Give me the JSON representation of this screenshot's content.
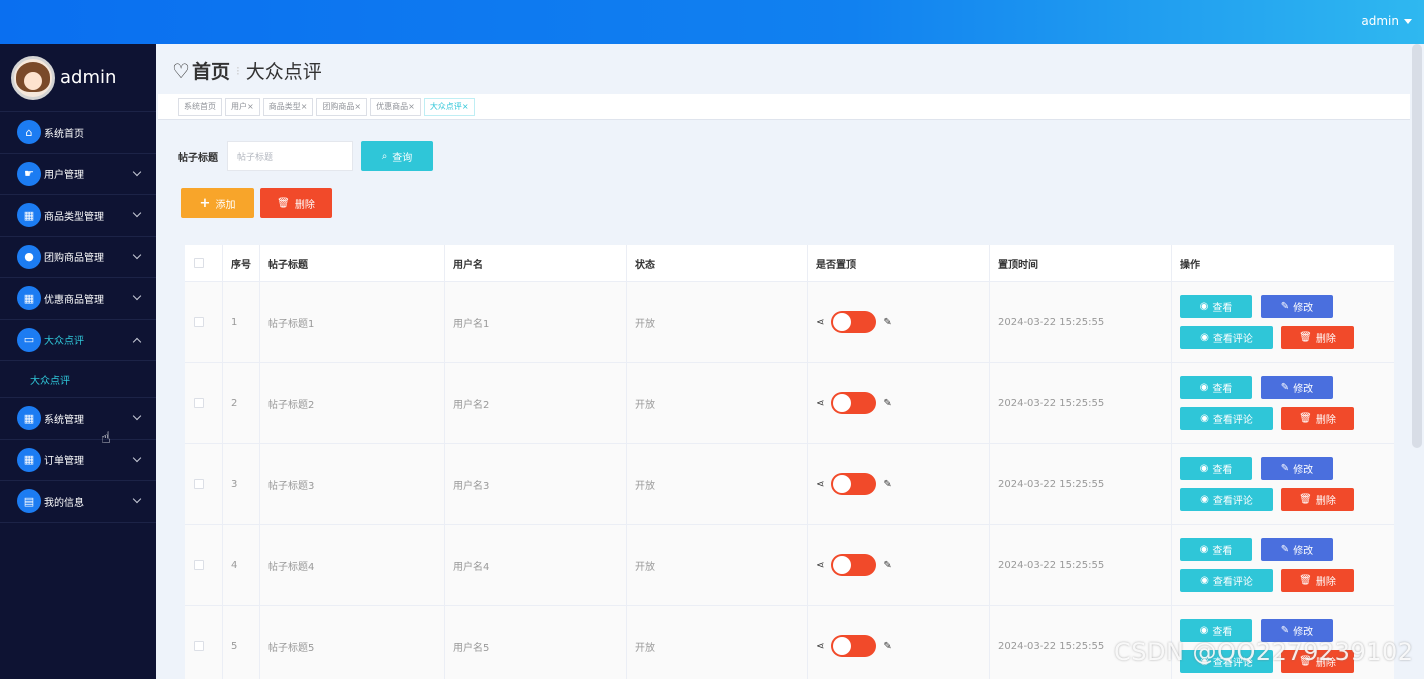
{
  "topbar": {
    "user_label": "admin"
  },
  "sidebar": {
    "admin_name": "admin",
    "items": [
      {
        "label": "系统首页",
        "icon": "home-icon",
        "expand": ""
      },
      {
        "label": "用户管理",
        "icon": "user-manage-icon",
        "expand": "down"
      },
      {
        "label": "商品类型管理",
        "icon": "grid-icon",
        "expand": "down"
      },
      {
        "label": "团购商品管理",
        "icon": "person-icon",
        "expand": "down"
      },
      {
        "label": "优惠商品管理",
        "icon": "grid-icon",
        "expand": "down"
      },
      {
        "label": "大众点评",
        "icon": "briefcase-icon",
        "expand": "up",
        "active": true
      },
      {
        "label": "系统管理",
        "icon": "grid-icon",
        "expand": "down"
      },
      {
        "label": "订单管理",
        "icon": "grid-icon",
        "expand": "down"
      },
      {
        "label": "我的信息",
        "icon": "id-card-icon",
        "expand": "down"
      }
    ],
    "sub_item": "大众点评"
  },
  "breadcrumb": {
    "home": "首页",
    "current": "大众点评"
  },
  "tabs": [
    {
      "label": "系统首页",
      "closable": false
    },
    {
      "label": "用户",
      "closable": true
    },
    {
      "label": "商品类型",
      "closable": true
    },
    {
      "label": "团购商品",
      "closable": true
    },
    {
      "label": "优惠商品",
      "closable": true
    },
    {
      "label": "大众点评",
      "closable": true,
      "active": true
    }
  ],
  "search": {
    "label": "帖子标题",
    "placeholder": "帖子标题",
    "button": "查询"
  },
  "actions": {
    "add": "添加",
    "delete": "删除"
  },
  "table": {
    "columns": [
      "",
      "序号",
      "帖子标题",
      "用户名",
      "状态",
      "是否置顶",
      "置顶时间",
      "操作"
    ],
    "rows": [
      {
        "index": "1",
        "title": "帖子标题1",
        "username": "用户名1",
        "status": "开放",
        "pinned": true,
        "time": "2024-03-22 15:25:55"
      },
      {
        "index": "2",
        "title": "帖子标题2",
        "username": "用户名2",
        "status": "开放",
        "pinned": true,
        "time": "2024-03-22 15:25:55"
      },
      {
        "index": "3",
        "title": "帖子标题3",
        "username": "用户名3",
        "status": "开放",
        "pinned": true,
        "time": "2024-03-22 15:25:55"
      },
      {
        "index": "4",
        "title": "帖子标题4",
        "username": "用户名4",
        "status": "开放",
        "pinned": true,
        "time": "2024-03-22 15:25:55"
      },
      {
        "index": "5",
        "title": "帖子标题5",
        "username": "用户名5",
        "status": "开放",
        "pinned": true,
        "time": "2024-03-22 15:25:55"
      }
    ],
    "row_actions": {
      "view": "查看",
      "edit": "修改",
      "comments": "查看评论",
      "delete": "删除"
    }
  },
  "watermark": "CSDN @QQ2279239102",
  "colors": {
    "accent": "#2fc6d8",
    "primary": "#1181f0",
    "danger": "#f14a2a",
    "warning": "#f8a52a",
    "edit": "#4a6fde",
    "sidebar": "#0e1333"
  }
}
